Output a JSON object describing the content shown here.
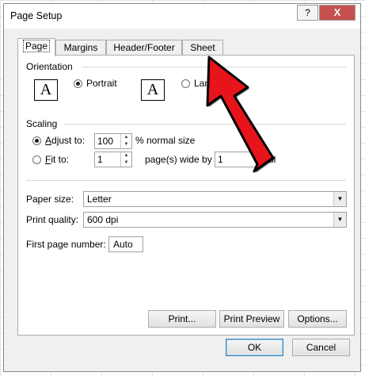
{
  "dialog": {
    "title": "Page Setup",
    "help_label": "?",
    "close_label": "X"
  },
  "tabs": [
    {
      "label": "Page",
      "active": true
    },
    {
      "label": "Margins"
    },
    {
      "label": "Header/Footer"
    },
    {
      "label": "Sheet"
    }
  ],
  "orientation": {
    "group_label": "Orientation",
    "icon_glyph": "A",
    "portrait_label": "Portrait",
    "portrait_selected": true,
    "landscape_label_visible": "Lan",
    "landscape_selected": false
  },
  "scaling": {
    "group_label": "Scaling",
    "adjust_label": "Adjust to:",
    "adjust_selected": true,
    "adjust_value": "100",
    "adjust_suffix": "% normal size",
    "fit_label": "Fit to:",
    "fit_selected": false,
    "fit_wide_value": "1",
    "fit_wide_suffix": "page(s) wide by",
    "fit_tall_value": "1",
    "fit_tall_suffix_visible": "tall"
  },
  "paper_size": {
    "label": "Paper size:",
    "value": "Letter"
  },
  "print_quality": {
    "label": "Print quality:",
    "value": "600 dpi"
  },
  "first_page_number": {
    "label": "First page number:",
    "value": "Auto"
  },
  "actions": {
    "print": "Print...",
    "print_preview": "Print Preview",
    "options": "Options..."
  },
  "footer": {
    "ok": "OK",
    "cancel": "Cancel"
  },
  "annotation": {
    "arrow_color": "#e8141b"
  }
}
